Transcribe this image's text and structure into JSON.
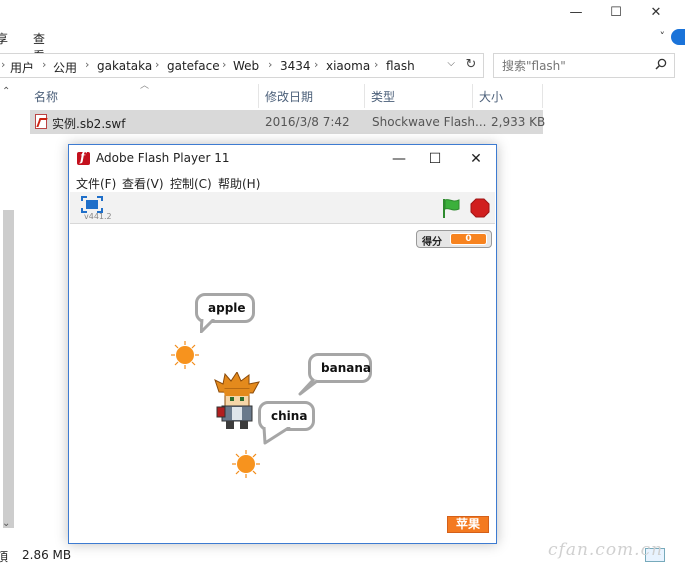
{
  "explorer": {
    "ribbon_tabs": [
      "享",
      "查看"
    ],
    "window_controls": {
      "minimize": "—",
      "maximize": "☐",
      "close": "✕",
      "ribbon_toggle": "˅"
    },
    "address_crumbs": [
      "用户",
      "公用",
      "gakataka",
      "gateface",
      "Web",
      "3434",
      "xiaoma",
      "flash"
    ],
    "address_separator": "›",
    "search_placeholder": "搜索\"flash\"",
    "columns": {
      "name": "名称",
      "modified": "修改日期",
      "type": "类型",
      "size": "大小"
    },
    "file": {
      "name": "实例.sb2.swf",
      "modified": "2016/3/8 7:42",
      "type": "Shockwave Flash...",
      "size": "2,933 KB"
    },
    "status": {
      "left_fragment": "頂",
      "size": "2.86 MB"
    }
  },
  "flash_window": {
    "title": "Adobe Flash Player 11",
    "controls": {
      "minimize": "—",
      "maximize": "☐",
      "close": "✕"
    },
    "menu": [
      "文件(F)",
      "查看(V)",
      "控制(C)",
      "帮助(H)"
    ]
  },
  "scratch": {
    "version": "v441.2",
    "score_label": "得分",
    "score_value": "0",
    "bubbles": {
      "apple": "apple",
      "banana": "banana",
      "china": "china"
    },
    "apple_button": "苹果"
  },
  "watermark": "cfan.com.cn",
  "colors": {
    "accent_blue": "#3d7bd1",
    "flash_red": "#c3101d",
    "scratch_orange": "#f7831f",
    "green_flag": "#3cb03c",
    "stop_red": "#d11f1f",
    "selected_row": "#d9d9d9"
  },
  "icons": {
    "file_icon": "pdf-like-swf-icon",
    "search_icon": "magnifier-icon",
    "refresh_icon": "refresh-icon",
    "fullscreen_icon": "fullscreen-icon",
    "green_flag_icon": "green-flag-icon",
    "stop_icon": "stop-sign-icon",
    "sun_icon": "sun-icon"
  }
}
